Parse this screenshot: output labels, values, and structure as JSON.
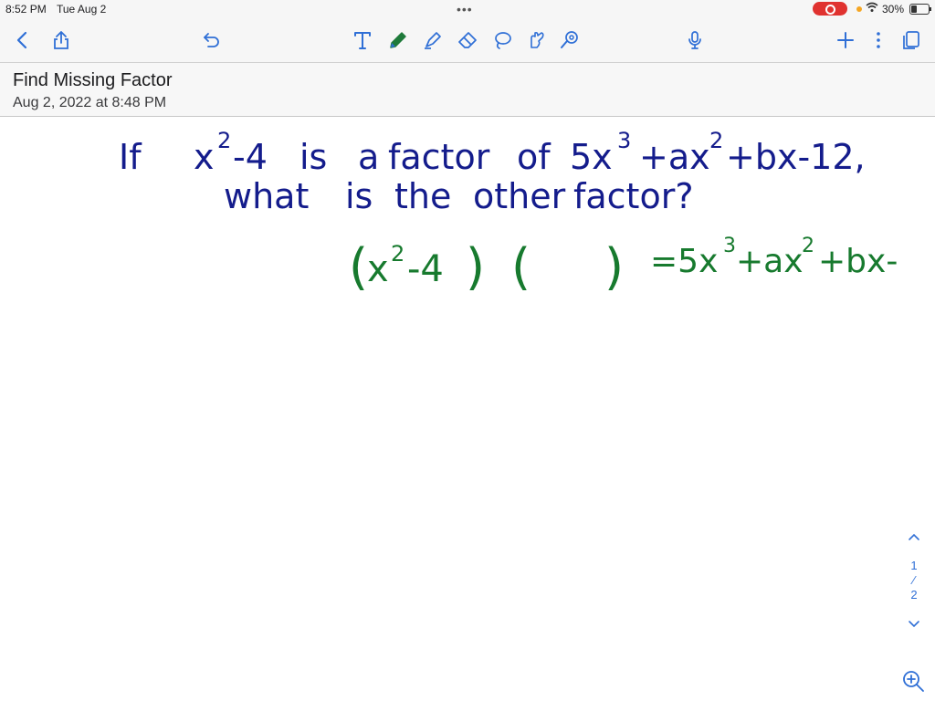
{
  "status_bar": {
    "time": "8:52 PM",
    "date": "Tue Aug 2",
    "battery": "30%"
  },
  "toolbar": {
    "icons": [
      "back-chevron-icon",
      "share-icon",
      "undo-icon",
      "text-tool-icon",
      "pen-tool-icon",
      "highlighter-icon",
      "eraser-icon",
      "lasso-icon",
      "shapes-icon",
      "image-tool-icon",
      "microphone-icon",
      "add-icon",
      "more-icon",
      "pages-icon"
    ],
    "accent": "#2f6fd6",
    "pen_color": "#1f7a3a"
  },
  "note": {
    "title": "Find Missing Factor",
    "date": "Aug 2, 2022 at 8:48 PM"
  },
  "handwriting": {
    "line1": "If x²-4 is a factor of 5x³+ax²+bx-12,",
    "line2": "what is the other factor?",
    "line3": "(x²-4) (    ) = 5x³+ax²+bx-",
    "blue_ink": "#141c8c",
    "green_ink": "#177a2e"
  },
  "pager": {
    "current": "1",
    "total": "2"
  }
}
